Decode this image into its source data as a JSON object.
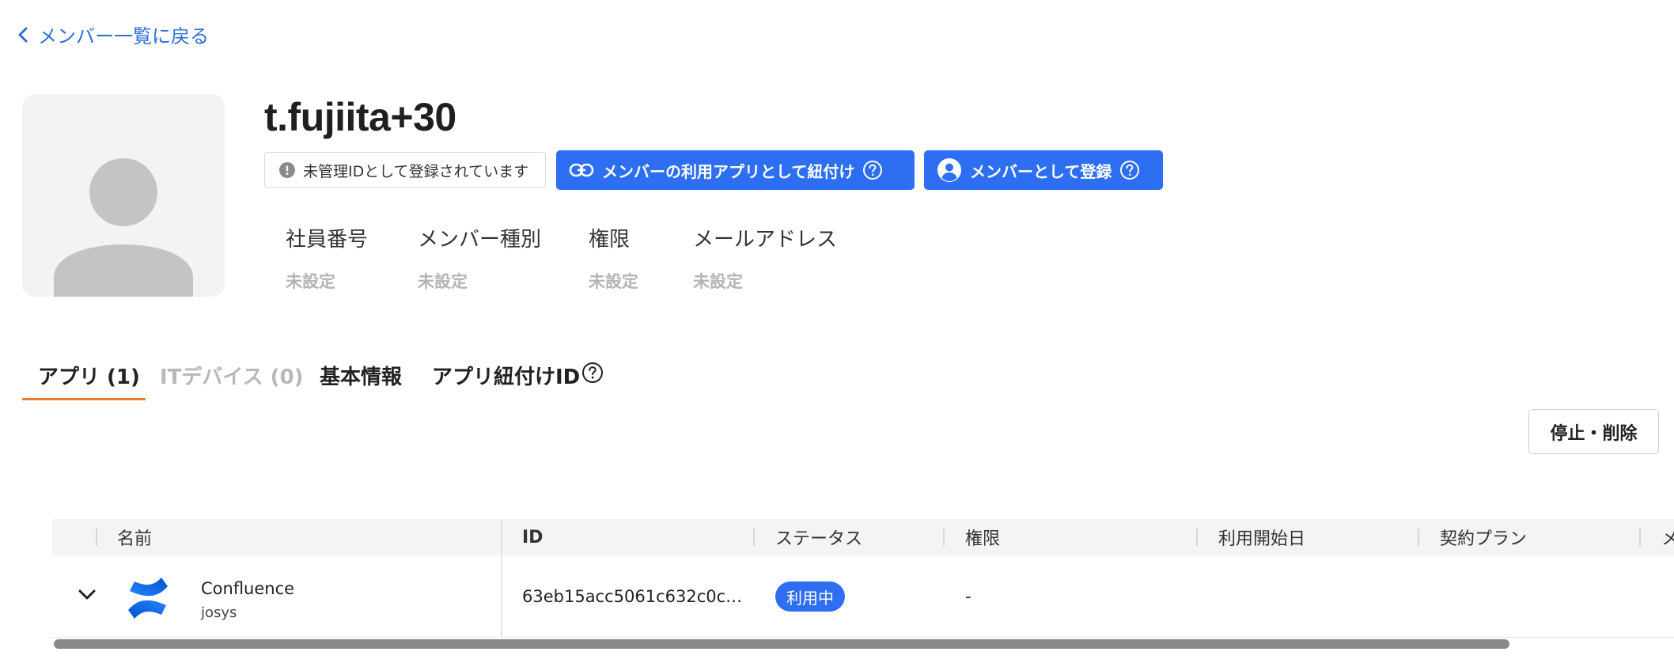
{
  "back_link": {
    "label": "メンバー一覧に戻る"
  },
  "member": {
    "name": "t.fujiita+30",
    "unmanaged_badge": "未管理IDとして登録されています",
    "info": [
      {
        "label": "社員番号",
        "value": "未設定"
      },
      {
        "label": "メンバー種別",
        "value": "未設定"
      },
      {
        "label": "権限",
        "value": "未設定"
      },
      {
        "label": "メールアドレス",
        "value": "未設定"
      }
    ]
  },
  "actions": {
    "link_app_label": "メンバーの利用アプリとして紐付け",
    "register_label": "メンバーとして登録",
    "stop_delete_label": "停止・削除"
  },
  "tabs": [
    {
      "label": "アプリ (1)",
      "state": "active"
    },
    {
      "label": "ITデバイス (0)",
      "state": "disabled"
    },
    {
      "label": "基本情報",
      "state": "normal"
    },
    {
      "label": "アプリ紐付けID",
      "state": "normal"
    }
  ],
  "table": {
    "headers": [
      "名前",
      "ID",
      "ステータス",
      "権限",
      "利用開始日",
      "契約プラン",
      "メ"
    ],
    "rows": [
      {
        "app_name": "Confluence",
        "tenant": "josys",
        "id": "63eb15acc5061c632c0c…",
        "status": "利用中",
        "permission": "-"
      }
    ]
  },
  "colors": {
    "primary": "#2d6ef3",
    "link": "#2f6ed8",
    "tab_underline": "#ef7d2c",
    "muted_text": "#b4b4b4"
  }
}
